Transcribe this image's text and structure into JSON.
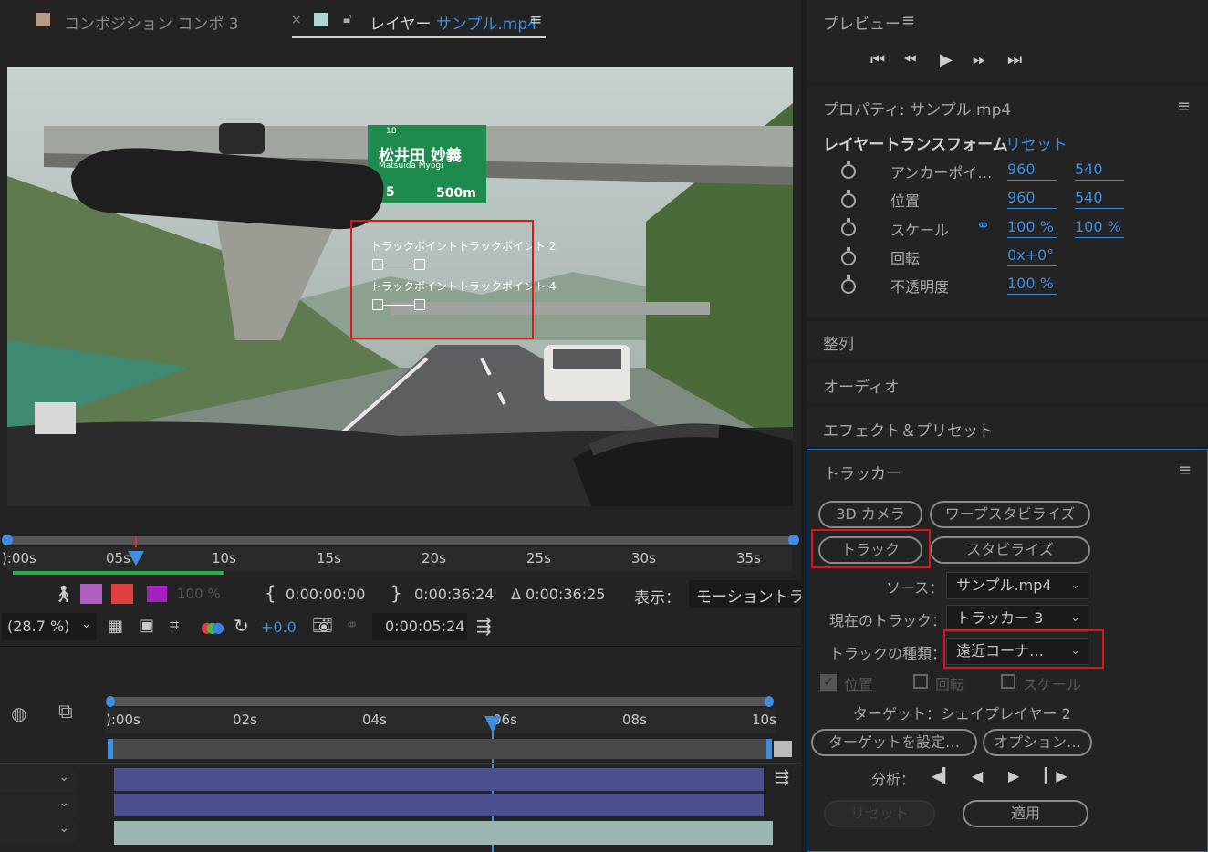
{
  "tabs": {
    "comp_tab": "コンポジション コンポ 3",
    "close": "×",
    "layer_prefix": "レイヤー",
    "layer_name": "サンプル.mp4",
    "menu": "≡"
  },
  "viewer": {
    "track_label_1": "トラックポイントトラックポイント 2",
    "track_label_2": "トラックポイントトラックポイント 4",
    "sign_line1": "松井田  妙義",
    "sign_line2": "Matsuida   Myogi",
    "sign_num": "18",
    "sign_dist": "500m",
    "sign_exit": "5"
  },
  "timebar": {
    "ticks": [
      "):00s",
      "05s",
      "10s",
      "15s",
      "20s",
      "25s",
      "30s",
      "35s"
    ],
    "zoom_small": "100 %",
    "in_time": "0:00:00:00",
    "out_time": "0:00:36:24",
    "duration": "Δ 0:00:36:25",
    "view_label": "表示：",
    "view_value": "モーショントラッ"
  },
  "toolbar2": {
    "zoom": "(28.7 %)",
    "exposure": "+0.0",
    "current_time": "0:00:05:24"
  },
  "timeline": {
    "ticks": [
      "):00s",
      "02s",
      "04s",
      "06s",
      "08s",
      "10s"
    ]
  },
  "preview": {
    "title": "プレビュー",
    "menu": "≡"
  },
  "properties": {
    "title": "プロパティ: サンプル.mp4",
    "menu": "≡",
    "group": "レイヤートランスフォーム",
    "reset": "リセット",
    "rows": [
      {
        "label": "アンカーポイ…",
        "v1": "960",
        "v2": "540"
      },
      {
        "label": "位置",
        "v1": "960",
        "v2": "540"
      },
      {
        "label": "スケール",
        "v1": "100 %",
        "v2": "100 %"
      },
      {
        "label": "回転",
        "v1": "0x+0°",
        "v2": ""
      },
      {
        "label": "不透明度",
        "v1": "100 %",
        "v2": ""
      }
    ]
  },
  "collapsed_panels": [
    "整列",
    "オーディオ",
    "エフェクト＆プリセット"
  ],
  "tracker": {
    "title": "トラッカー",
    "menu": "≡",
    "btn_3d": "3D カメラ",
    "btn_warp": "ワープスタビライズ",
    "btn_track": "トラック",
    "btn_stab": "スタビライズ",
    "source_label": "ソース：",
    "source_value": "サンプル.mp4",
    "current_label": "現在のトラック：",
    "current_value": "トラッカー 3",
    "type_label": "トラックの種類：",
    "type_value": "遠近コーナ…",
    "chk_position": "位置",
    "chk_rotation": "回転",
    "chk_scale": "スケール",
    "target": "ターゲット：シェイプレイヤー 2",
    "btn_set_target": "ターゲットを設定…",
    "btn_options": "オプション…",
    "analyze_label": "分析：",
    "btn_reset": "リセット",
    "btn_apply": "適用"
  },
  "colors": {
    "accent": "#3d8ee0",
    "highlight": "#e0141c",
    "layer_bar": "#4b4f8c"
  }
}
